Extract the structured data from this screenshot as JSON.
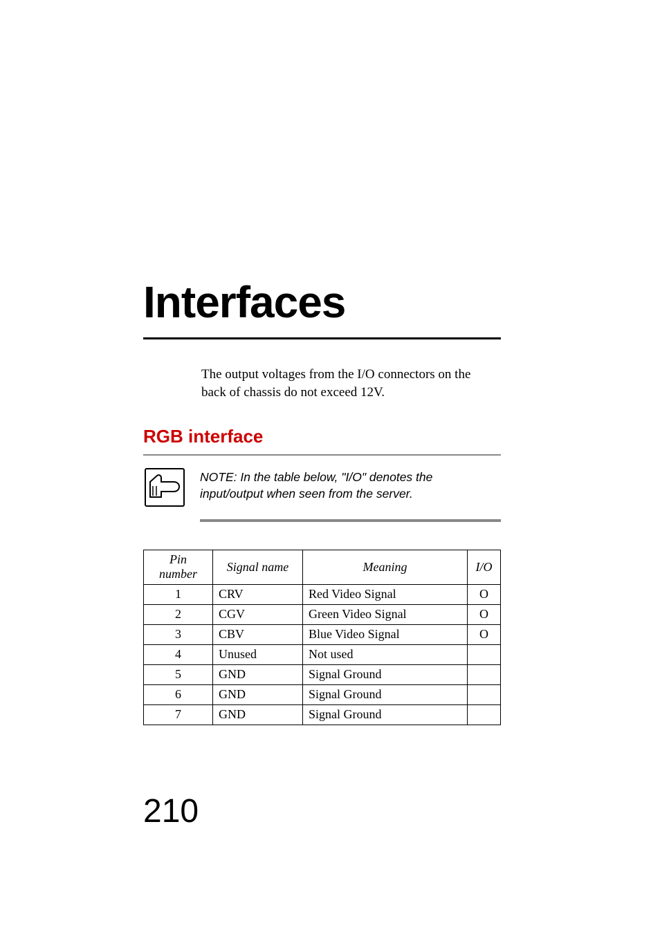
{
  "chapter": {
    "title": "Interfaces"
  },
  "intro": "The output voltages from the I/O connectors on the back of chassis do not exceed 12V.",
  "section": {
    "heading": "RGB interface"
  },
  "note": {
    "text": "NOTE: In the table below, \"I/O\" denotes the input/output when seen from the server."
  },
  "table": {
    "headers": {
      "pin": "Pin number",
      "signal": "Signal name",
      "meaning": "Meaning",
      "io": "I/O"
    },
    "rows": [
      {
        "pin": "1",
        "signal": "CRV",
        "meaning": "Red Video Signal",
        "io": "O"
      },
      {
        "pin": "2",
        "signal": "CGV",
        "meaning": "Green Video Signal",
        "io": "O"
      },
      {
        "pin": "3",
        "signal": "CBV",
        "meaning": "Blue Video Signal",
        "io": "O"
      },
      {
        "pin": "4",
        "signal": "Unused",
        "meaning": "Not used",
        "io": ""
      },
      {
        "pin": "5",
        "signal": "GND",
        "meaning": "Signal Ground",
        "io": ""
      },
      {
        "pin": "6",
        "signal": "GND",
        "meaning": "Signal Ground",
        "io": ""
      },
      {
        "pin": "7",
        "signal": "GND",
        "meaning": "Signal Ground",
        "io": ""
      }
    ]
  },
  "page_number": "210"
}
